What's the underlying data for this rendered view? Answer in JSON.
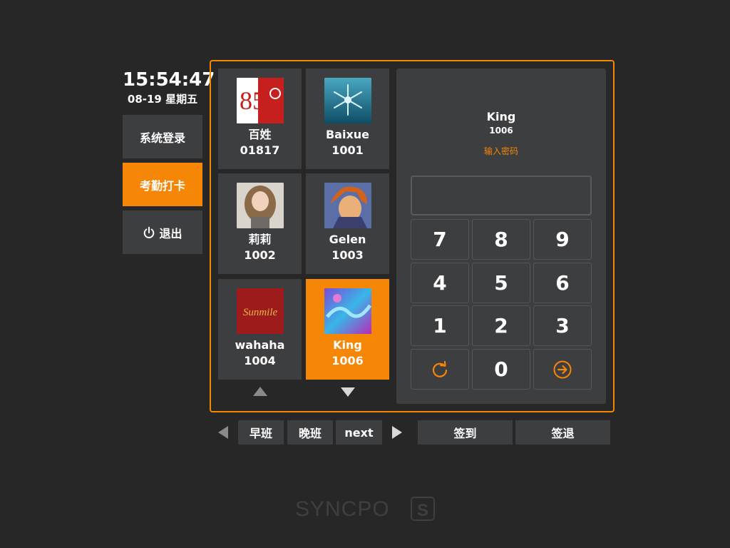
{
  "clock": {
    "time": "15:54:47",
    "date": "08-19 星期五"
  },
  "side_menu": {
    "login": "系统登录",
    "attendance": "考勤打卡",
    "logout": "退出"
  },
  "users": [
    {
      "name": "百姓",
      "id": "01817"
    },
    {
      "name": "Baixue",
      "id": "1001"
    },
    {
      "name": "莉莉",
      "id": "1002"
    },
    {
      "name": "Gelen",
      "id": "1003"
    },
    {
      "name": "wahaha",
      "id": "1004"
    },
    {
      "name": "King",
      "id": "1006"
    }
  ],
  "avatar_texts": {
    "logo_85": "85",
    "sunmile": "Sunmile"
  },
  "selected_user": {
    "name": "King",
    "id": "1006",
    "hint": "输入密码"
  },
  "password": {
    "value": "",
    "placeholder": ""
  },
  "keypad": [
    "7",
    "8",
    "9",
    "4",
    "5",
    "6",
    "1",
    "2",
    "3",
    "0"
  ],
  "shifts": {
    "morning": "早班",
    "evening": "晚班",
    "next": "next"
  },
  "actions": {
    "sign_in": "签到",
    "sign_out": "签退"
  },
  "brand": {
    "name": "SYNCPO",
    "mark": "S"
  },
  "colors": {
    "accent": "#f68605",
    "background": "#272727",
    "panel": "#3d3e40"
  },
  "icons": {
    "logout": "power-icon",
    "reset": "refresh-icon",
    "submit": "arrow-circle-right-icon",
    "scroll_up": "triangle-up-icon",
    "scroll_down": "triangle-down-icon",
    "prev": "triangle-left-icon",
    "next": "triangle-right-icon"
  }
}
